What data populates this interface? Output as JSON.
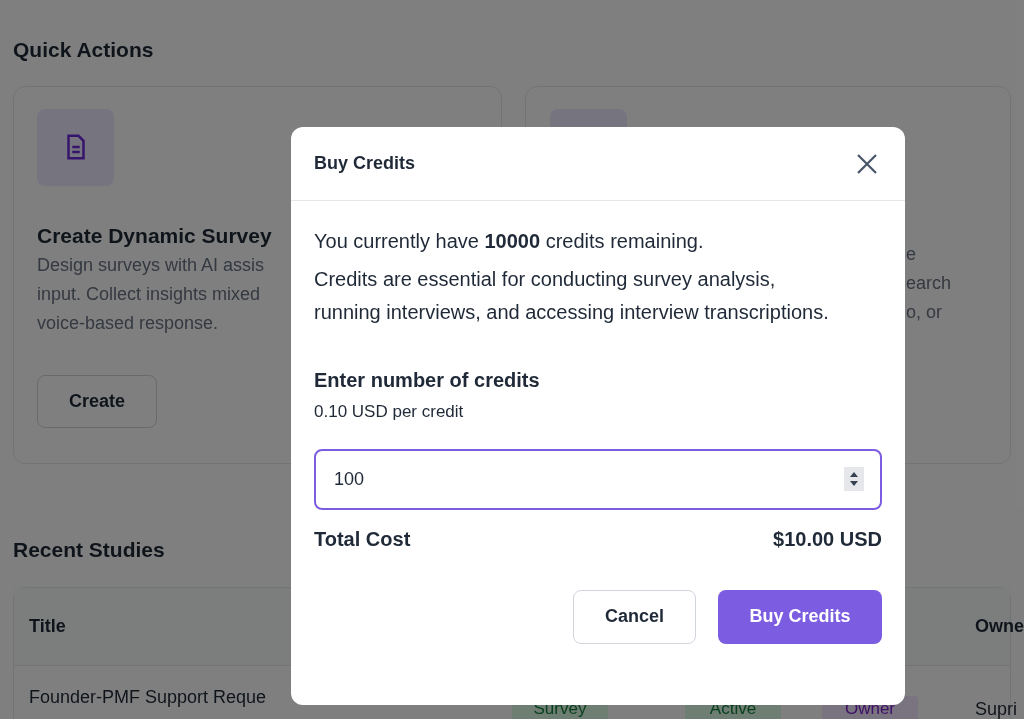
{
  "quick_actions": {
    "title": "Quick Actions",
    "cards": [
      {
        "title": "Create Dynamic Survey",
        "description_lines": [
          "Design surveys with AI assis",
          "input. Collect insights mixed",
          "voice-based response."
        ],
        "button": "Create"
      },
      {
        "description_lines": [
          "e",
          "earch",
          "o, or"
        ]
      }
    ]
  },
  "recent_studies": {
    "title": "Recent Studies",
    "table": {
      "columns": [
        "Title",
        "Owne"
      ],
      "rows": [
        {
          "title": "Founder-PMF Support Reque",
          "tags": [
            {
              "text": "Survey",
              "kind": "type"
            },
            {
              "text": "Active",
              "kind": "status"
            },
            {
              "text": "Owner",
              "kind": "role"
            }
          ],
          "owner": "Supri"
        }
      ]
    }
  },
  "dialog": {
    "title": "Buy Credits",
    "remaining": "You currently have **10000** credits remaining.",
    "info": "Credits are essential for conducting survey analysis, running interviews, and accessing interview transcriptions.",
    "field_label": "Enter number of credits",
    "field_hint": "0.10 USD per credit",
    "value": "100",
    "total_label": "Total Cost",
    "total_value": "$10.00 USD",
    "buttons": [
      {
        "kind": "secondary",
        "label": "Cancel"
      },
      {
        "kind": "primary",
        "label": "Buy Credits"
      }
    ]
  }
}
